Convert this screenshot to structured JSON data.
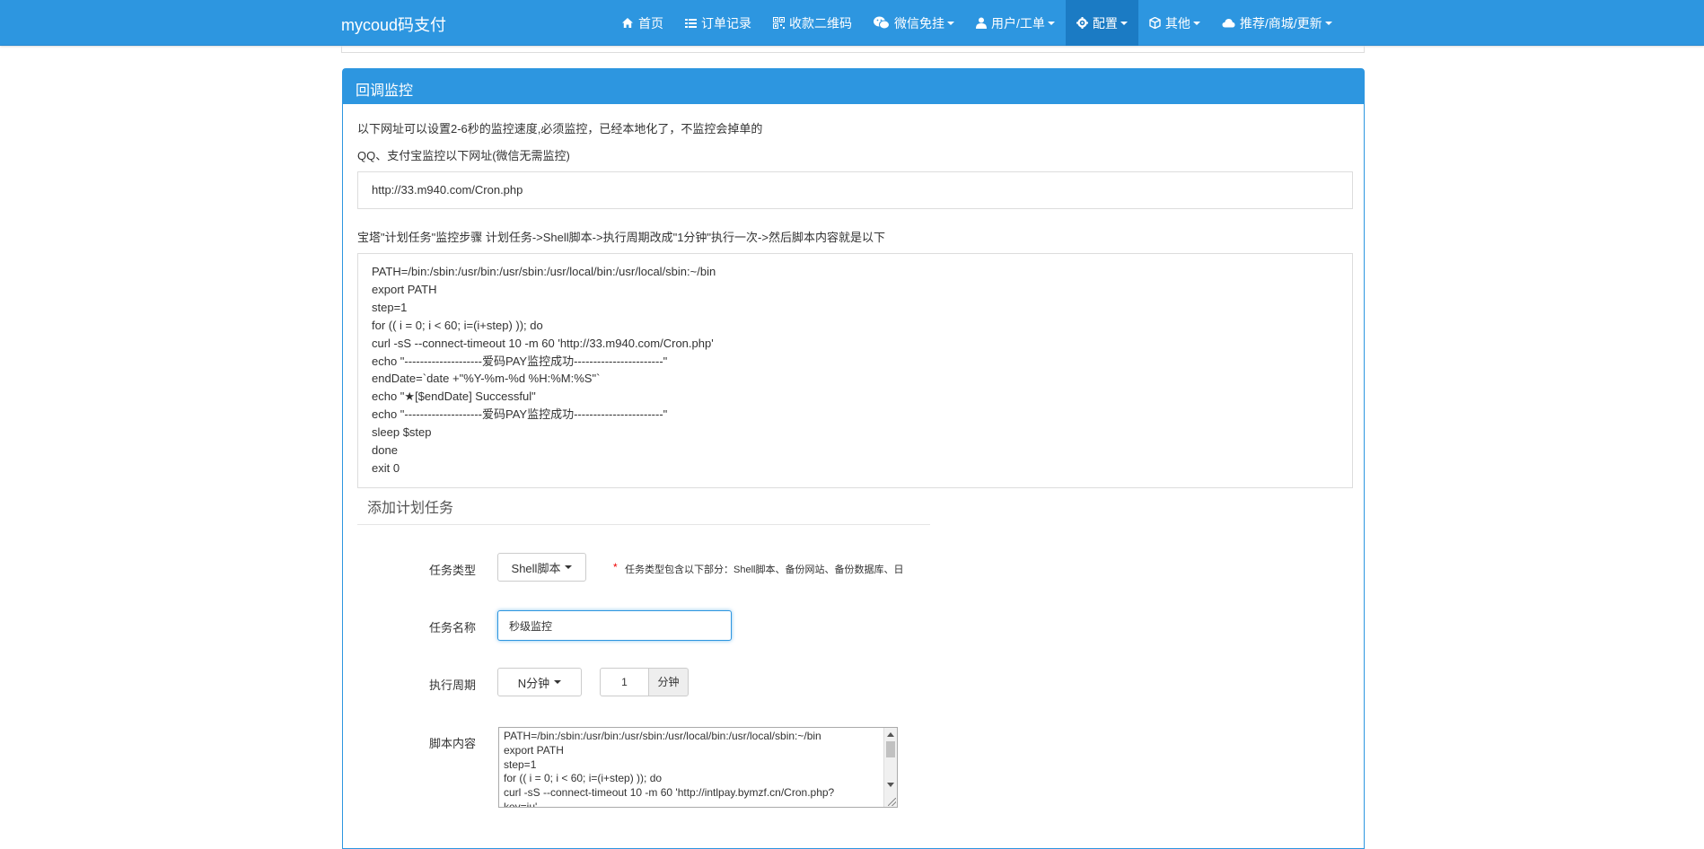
{
  "brand": "mycoud码支付",
  "nav": [
    {
      "label": "首页",
      "icon": "home-icon",
      "caret": false
    },
    {
      "label": "订单记录",
      "icon": "list-icon",
      "caret": false
    },
    {
      "label": "收款二维码",
      "icon": "qrcode-icon",
      "caret": false
    },
    {
      "label": "微信免挂",
      "icon": "wechat-icon",
      "caret": true
    },
    {
      "label": "用户/工单",
      "icon": "user-icon",
      "caret": true
    },
    {
      "label": "配置",
      "icon": "gear-icon",
      "caret": true,
      "active": true
    },
    {
      "label": "其他",
      "icon": "cube-icon",
      "caret": true
    },
    {
      "label": "推荐/商城/更新",
      "icon": "cloud-icon",
      "caret": true
    }
  ],
  "panel": {
    "title": "回调监控",
    "line1": "以下网址可以设置2-6秒的监控速度,必须监控，已经本地化了，不监控会掉单的",
    "line2": "QQ、支付宝监控以下网址(微信无需监控)",
    "url": "http://33.m940.com/Cron.php",
    "line3": "宝塔\"计划任务\"监控步骤 计划任务->Shell脚本->执行周期改成\"1分钟\"执行一次->然后脚本内容就是以下",
    "code": [
      "PATH=/bin:/sbin:/usr/bin:/usr/sbin:/usr/local/bin:/usr/local/sbin:~/bin",
      "export PATH",
      "step=1",
      "for (( i = 0; i < 60; i=(i+step) )); do",
      "curl -sS --connect-timeout 10 -m 60 'http://33.m940.com/Cron.php'",
      "echo \"--------------------爱码PAY监控成功-----------------------\"",
      "endDate=`date +\"%Y-%m-%d %H:%M:%S\"`",
      "echo \"★[$endDate] Successful\"",
      "echo \"--------------------爱码PAY监控成功-----------------------\"",
      "sleep $step",
      "done",
      "exit 0"
    ]
  },
  "form": {
    "title": "添加计划任务",
    "task_type_label": "任务类型",
    "task_type_value": "Shell脚本",
    "task_type_hint_star": "*",
    "task_type_hint": "任务类型包含以下部分：Shell脚本、备份网站、备份数据库、日",
    "task_name_label": "任务名称",
    "task_name_value": "秒级监控",
    "period_label": "执行周期",
    "period_value": "N分钟",
    "period_number": "1",
    "period_unit": "分钟",
    "script_label": "脚本内容",
    "script_lines": [
      "PATH=/bin:/sbin:/usr/bin:/usr/sbin:/usr/local/bin:/usr/local/sbin:~/bin",
      "export PATH",
      "step=1",
      "for (( i = 0; i < 60; i=(i+step) )); do",
      "curl -sS --connect-timeout 10 -m 60 'http://intlpay.bymzf.cn/Cron.php?",
      "key=ju'"
    ]
  },
  "colors": {
    "navbar": "#2d96e0",
    "nav_active": "#1b7bc4",
    "panel_heading": "#2d96e0"
  }
}
